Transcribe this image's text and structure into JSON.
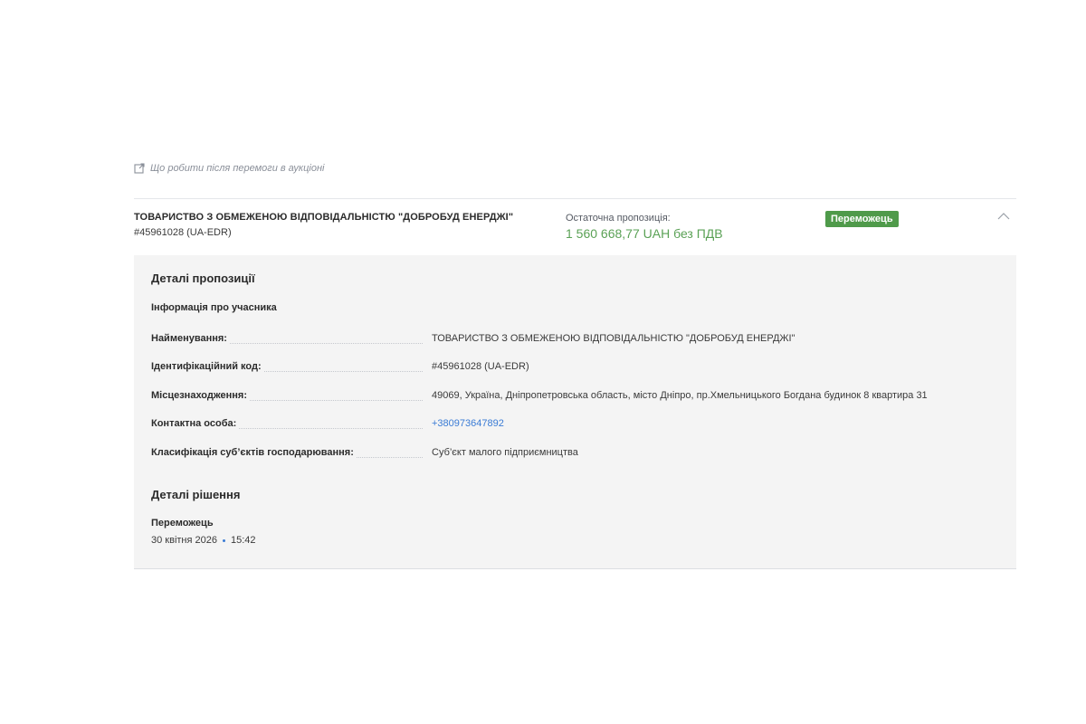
{
  "after_win_link": {
    "icon": "external-link-icon",
    "label": "Що робити після перемоги в аукціоні"
  },
  "bid": {
    "supplier_name": "ТОВАРИСТВО З ОБМЕЖЕНОЮ ВІДПОВІДАЛЬНІСТЮ \"ДОБРОБУД ЕНЕРДЖІ\"",
    "supplier_code": "#45961028 (UA-EDR)",
    "offer_label": "Остаточна пропозиція:",
    "offer_value": "1 560 668,77 UAH без ПДВ",
    "status_badge": "Переможець",
    "toggle_icon": "chevron-up-icon",
    "colors": {
      "offer_value": "#5aa155",
      "badge_bg": "#4f9a4a",
      "link": "#3a7bd5"
    }
  },
  "details": {
    "title": "Деталі пропозиції",
    "participant_subtitle": "Інформація про учасника",
    "rows": [
      {
        "label": "Найменування:",
        "value": "ТОВАРИСТВО З ОБМЕЖЕНОЮ ВІДПОВІДАЛЬНІСТЮ \"ДОБРОБУД ЕНЕРДЖІ\""
      },
      {
        "label": "Ідентифікаційний код:",
        "value": "#45961028 (UA-EDR)"
      },
      {
        "label": "Місцезнаходження:",
        "value": "49069, Україна, Дніпропетровська область, місто Дніпро, пр.Хмельницького Богдана будинок 8 квартира 31"
      },
      {
        "label": "Контактна особа:",
        "value": "+380973647892"
      },
      {
        "label": "Класифікація суб’єктів господарювання:",
        "value": "Суб’єкт малого підприємництва"
      }
    ]
  },
  "decision": {
    "title": "Деталі рішення",
    "status": "Переможець",
    "date": "30 квітня 2026",
    "time": "15:42"
  }
}
